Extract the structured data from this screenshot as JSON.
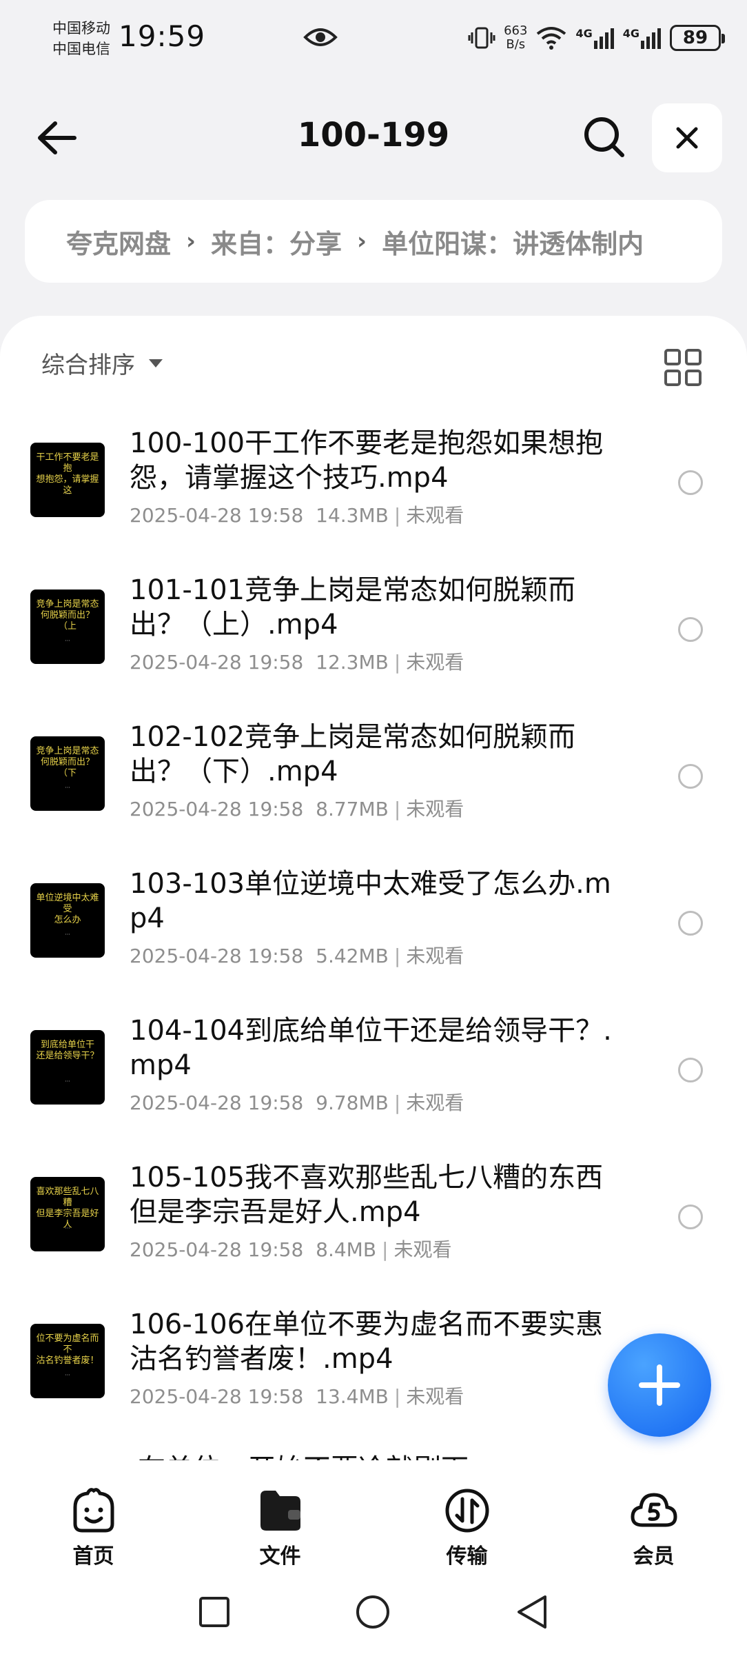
{
  "status_bar": {
    "carrier_1": "中国移动",
    "carrier_2": "中国电信",
    "time": "19:59",
    "net_speed_value": "663",
    "net_speed_unit": "B/s",
    "signal_1": "4G",
    "signal_2": "4G",
    "battery": "89"
  },
  "header": {
    "title": "100-199"
  },
  "breadcrumb": {
    "items": [
      "夸克网盘",
      "来自：分享",
      "单位阳谋：讲透体制内"
    ]
  },
  "toolbar": {
    "sort_label": "综合排序"
  },
  "files": [
    {
      "name": "100-100干工作不要老是抱怨如果想抱怨，请掌握这个技巧.mp4",
      "date": "2025-04-28 19:58",
      "size": "14.3MB",
      "status": "未观看",
      "thumb_text": "干工作不要老是抱\n想抱怨，请掌握这"
    },
    {
      "name": "101-101竞争上岗是常态如何脱颖而出？（上）.mp4",
      "date": "2025-04-28 19:58",
      "size": "12.3MB",
      "status": "未观看",
      "thumb_text": "竞争上岗是常态\n何脱颖而出？（上"
    },
    {
      "name": "102-102竞争上岗是常态如何脱颖而出？（下）.mp4",
      "date": "2025-04-28 19:58",
      "size": "8.77MB",
      "status": "未观看",
      "thumb_text": "竞争上岗是常态\n何脱颖而出？（下"
    },
    {
      "name": "103-103单位逆境中太难受了怎么办.mp4",
      "date": "2025-04-28 19:58",
      "size": "5.42MB",
      "status": "未观看",
      "thumb_text": "单位逆境中太难受\n怎么办"
    },
    {
      "name": "104-104到底给单位干还是给领导干？.mp4",
      "date": "2025-04-28 19:58",
      "size": "9.78MB",
      "status": "未观看",
      "thumb_text": "到底给单位干\n还是给领导干？"
    },
    {
      "name": "105-105我不喜欢那些乱七八糟的东西但是李宗吾是好人.mp4",
      "date": "2025-04-28 19:58",
      "size": "8.4MB",
      "status": "未观看",
      "thumb_text": "喜欢那些乱七八糟\n但是李宗吾是好人"
    },
    {
      "name": "106-106在单位不要为虚名而不要实惠沽名钓誉者废！.mp4",
      "date": "2025-04-28 19:58",
      "size": "13.4MB",
      "status": "未观看",
      "thumb_text": "位不要为虚名而不\n沽名钓誉者废！"
    }
  ],
  "partial_row_text": "在单位一开始不要冷就剔下",
  "bottom_nav": [
    {
      "label": "首页",
      "icon": "home-face-icon"
    },
    {
      "label": "文件",
      "icon": "folder-icon"
    },
    {
      "label": "传输",
      "icon": "transfer-icon"
    },
    {
      "label": "会员",
      "icon": "vip-cloud-icon"
    }
  ],
  "colors": {
    "accent": "#1466f0",
    "background": "#f2f2f4",
    "meta_text": "#8e8e8e"
  }
}
